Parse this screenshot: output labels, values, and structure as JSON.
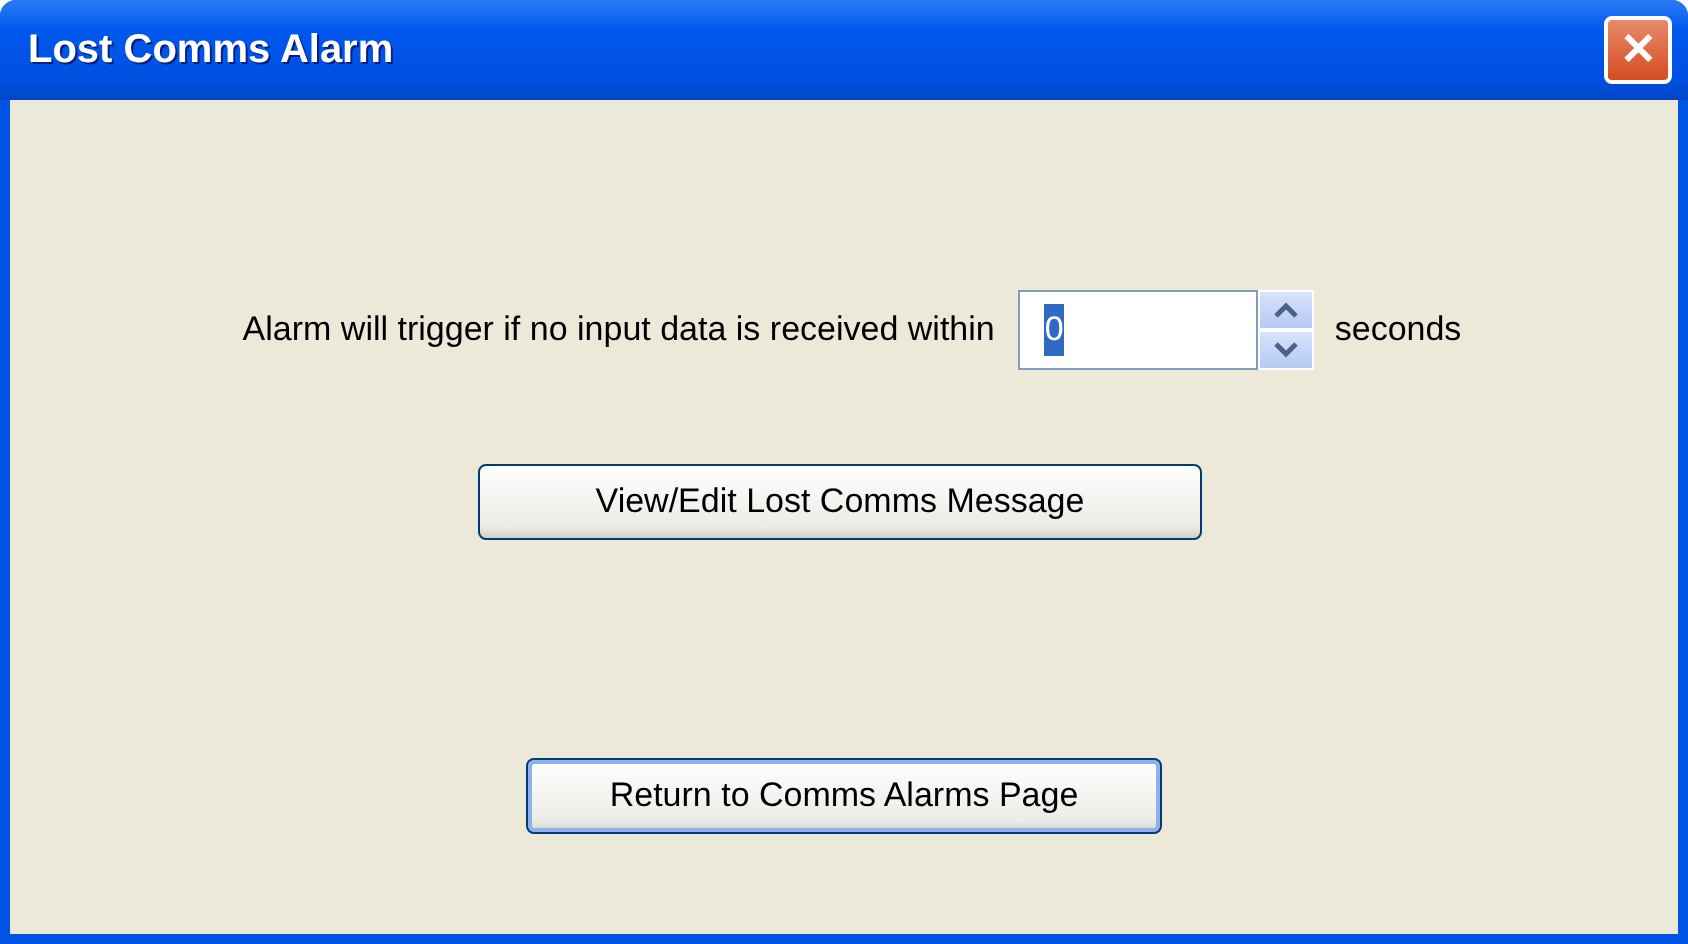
{
  "window": {
    "title": "Lost Comms Alarm",
    "close_label": "✕"
  },
  "timeout": {
    "label": "Alarm will trigger if no input data is received within",
    "value": "0",
    "value_selected": true,
    "unit": "seconds"
  },
  "buttons": [
    {
      "label": "View/Edit Lost Comms Message",
      "default": false
    },
    {
      "label": "Return to Comms Alarms Page",
      "default": true
    }
  ]
}
